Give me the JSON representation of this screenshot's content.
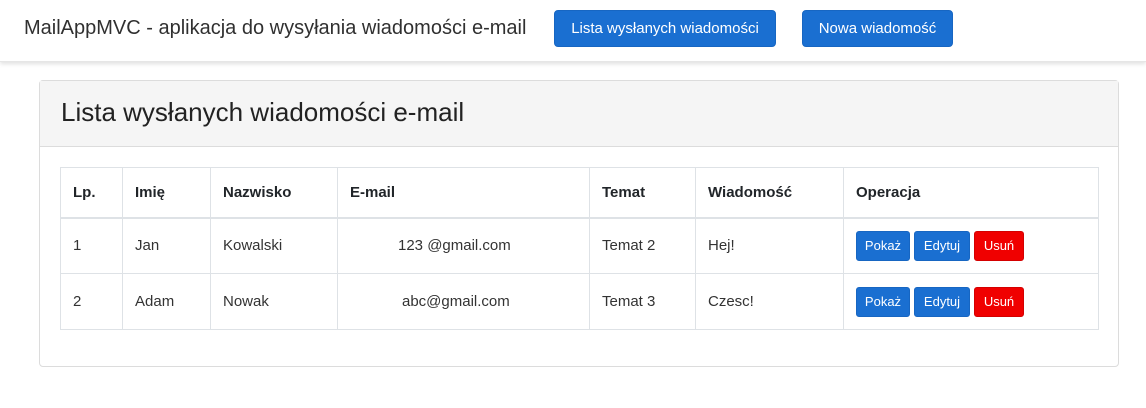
{
  "navbar": {
    "brand": "MailAppMVC - aplikacja do wysyłania wiadomości e-mail",
    "list_button": "Lista wysłanych wiadomości",
    "new_button": "Nowa wiadomość"
  },
  "card": {
    "title": "Lista wysłanych wiadomości e-mail"
  },
  "table": {
    "headers": [
      "Lp.",
      "Imię",
      "Nazwisko",
      "E-mail",
      "Temat",
      "Wiadomość",
      "Operacja"
    ],
    "rows": [
      {
        "lp": "1",
        "first_name": "Jan",
        "last_name": "Kowalski",
        "email": "123 @gmail.com",
        "subject": "Temat 2",
        "message": "Hej!"
      },
      {
        "lp": "2",
        "first_name": "Adam",
        "last_name": "Nowak",
        "email": "abc@gmail.com",
        "subject": "Temat 3",
        "message": "Czesc!"
      }
    ],
    "actions": {
      "show": "Pokaż",
      "edit": "Edytuj",
      "delete": "Usuń"
    }
  },
  "colors": {
    "primary": "#1a6fd1",
    "danger": "#f00000"
  }
}
